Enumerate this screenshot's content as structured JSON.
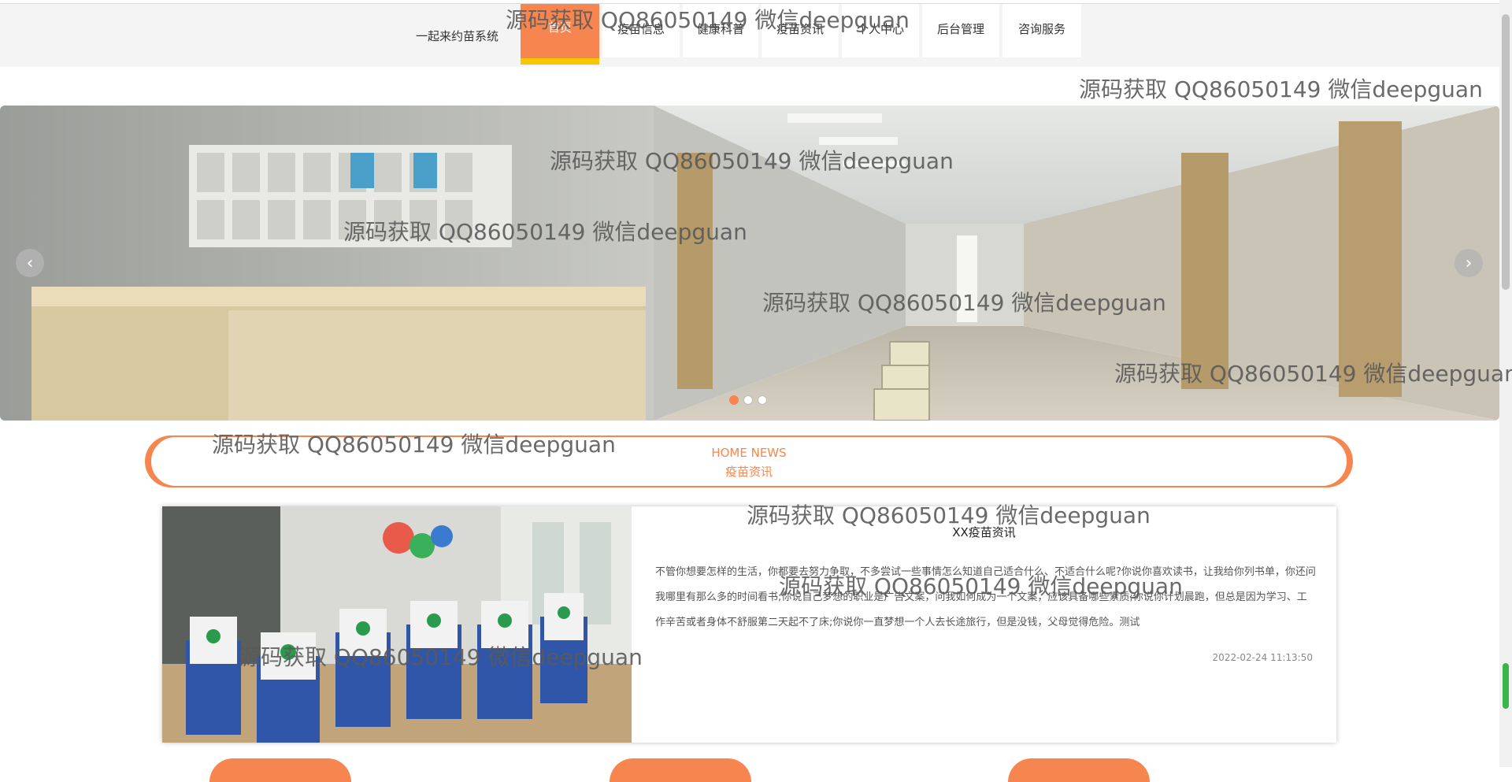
{
  "header": {
    "brand": "一起来约苗系统",
    "nav": [
      {
        "label": "首页",
        "active": true
      },
      {
        "label": "疫苗信息"
      },
      {
        "label": "健康科普"
      },
      {
        "label": "疫苗资讯"
      },
      {
        "label": "个人中心"
      },
      {
        "label": "后台管理"
      },
      {
        "label": "咨询服务"
      }
    ]
  },
  "banner": {
    "prev_icon": "‹",
    "next_icon": "›",
    "slide_count": 3,
    "active_slide": 1
  },
  "section": {
    "title_en": "HOME NEWS",
    "title_cn": "疫苗资讯"
  },
  "news": {
    "title": "XX疫苗资讯",
    "body": "不管你想要怎样的生活，你都要去努力争取，不多尝试一些事情怎么知道自己适合什么、不适合什么呢?你说你喜欢读书，让我给你列书单，你还问我哪里有那么多的时间看书;你说自己梦想的职业是广告文案，问我如何成为一个文案，应该具备哪些素质;你说你计划晨跑，但总是因为学习、工作辛苦或者身体不舒服第二天起不了床;你说你一直梦想一个人去长途旅行，但是没钱，父母觉得危险。测试",
    "date": "2022-02-24 11:13:50"
  },
  "watermark": "源码获取 QQ86050149 微信deepguan",
  "colors": {
    "accent": "#f7854f",
    "active_underline": "#f9c600"
  }
}
